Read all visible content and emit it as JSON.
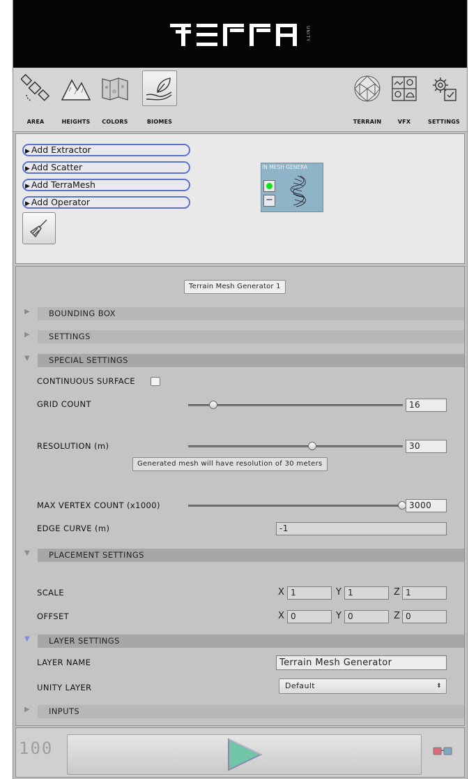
{
  "header": {
    "logo": "ΞΓΓΠ",
    "logo_sub": "UNITY"
  },
  "toolbar": {
    "tools": [
      {
        "label": "AREA",
        "icon": "satellite-icon"
      },
      {
        "label": "HEIGHTS",
        "icon": "mountains-icon"
      },
      {
        "label": "COLORS",
        "icon": "colormap-icon"
      },
      {
        "label": "BIOMES",
        "icon": "leaf-hand-icon",
        "active": true
      },
      {
        "label": "TERRAIN",
        "icon": "globe-mesh-icon"
      },
      {
        "label": "VFX",
        "icon": "vfx-grid-icon"
      },
      {
        "label": "SETTINGS",
        "icon": "gears-icon"
      }
    ]
  },
  "nodes_panel": {
    "add_buttons": [
      "Add Extractor",
      "Add Scatter",
      "Add TerraMesh",
      "Add Operator"
    ],
    "clear_icon": "broom-icon",
    "node": {
      "title": "IN MESH GENERA",
      "minus": "−"
    }
  },
  "inspector": {
    "generator_name": "Terrain Mesh Generator 1",
    "sections": {
      "bounding_box": "BOUNDING BOX",
      "settings": "SETTINGS",
      "special": "SPECIAL SETTINGS",
      "placement": "PLACEMENT SETTINGS",
      "layer": "LAYER SETTINGS",
      "inputs": "INPUTS"
    },
    "special": {
      "continuous_surface_label": "CONTINUOUS SURFACE",
      "continuous_surface": false,
      "grid_count_label": "GRID COUNT",
      "grid_count": "16",
      "grid_count_fraction": 0.12,
      "resolution_label": "RESOLUTION (m)",
      "resolution": "30",
      "resolution_fraction": 0.58,
      "resolution_note": "Generated mesh will have resolution of  30  meters",
      "max_vertex_label": "MAX VERTEX COUNT (x1000)",
      "max_vertex": "3000",
      "max_vertex_fraction": 1.0,
      "edge_curve_label": "EDGE CURVE (m)",
      "edge_curve": "-1"
    },
    "placement": {
      "scale_label": "SCALE",
      "scale": {
        "x": "1",
        "y": "1",
        "z": "1"
      },
      "offset_label": "OFFSET",
      "offset": {
        "x": "0",
        "y": "0",
        "z": "0"
      },
      "axes": {
        "x": "X",
        "y": "Y",
        "z": "Z"
      }
    },
    "layer": {
      "layer_name_label": "LAYER NAME",
      "layer_name": "Terrain Mesh Generator",
      "unity_layer_label": "UNITY LAYER",
      "unity_layer": "Default"
    }
  },
  "bottom_bar": {
    "counter": "100",
    "play_icon": "play-icon",
    "glasses_icon": "3d-glasses-icon"
  },
  "colors": {
    "header_bg": "#050505",
    "add_button_border": "#5b73cc",
    "node_bg": "#8fb4c7",
    "node_dot": "#13e01e",
    "play_fill": "#72c6a8"
  }
}
